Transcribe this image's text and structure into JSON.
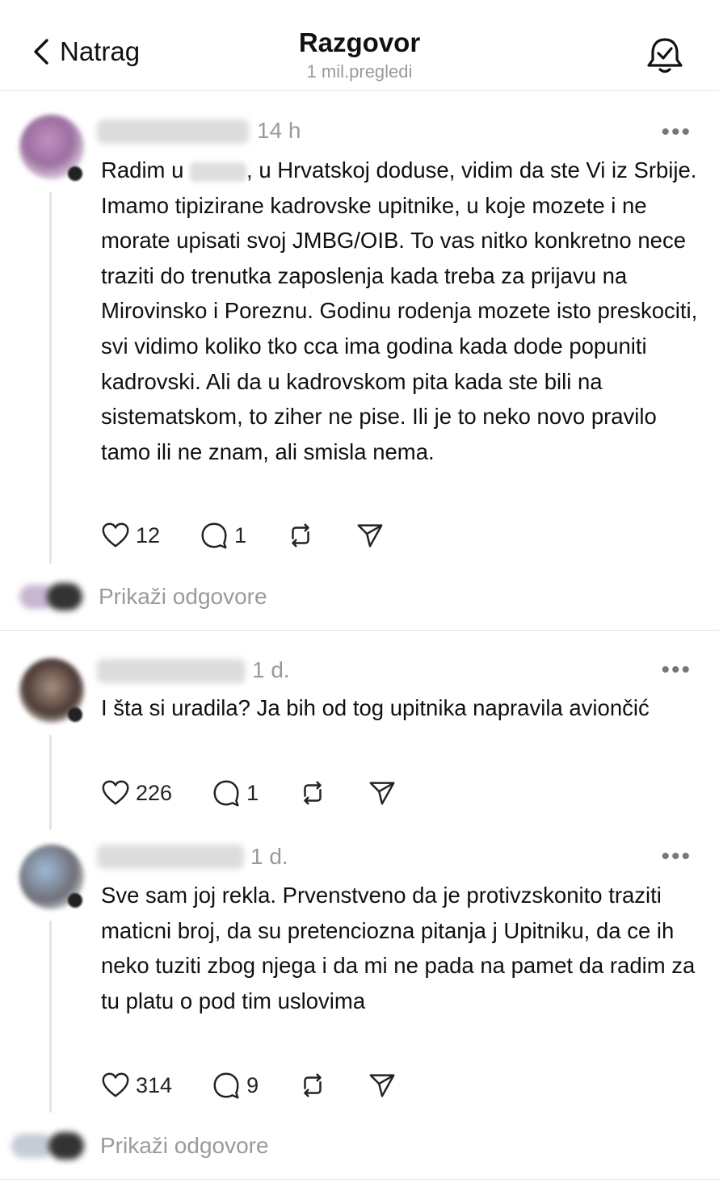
{
  "header": {
    "back_label": "Natrag",
    "title": "Razgovor",
    "subtitle": "1 mil.pregledi"
  },
  "posts": [
    {
      "time": "14 h",
      "more": "•••",
      "text_before": "Radim u",
      "text_after": ", u Hrvatskoj doduse, vidim da ste Vi iz Srbije. Imamo tipizirane kadrovske upitnike, u koje mozete i ne morate upisati svoj JMBG/OIB. To vas nitko konkretno nece traziti do trenutka zaposlenja kada treba za prijavu na Mirovinsko i Poreznu. Godinu rodenja mozete isto preskociti, svi vidimo koliko tko cca ima godina kada dode popuniti kadrovski. Ali da u kadrovskom pita kada ste bili na sistematskom, to ziher ne pise. Ili je to neko novo pravilo tamo ili ne znam, ali smisla nema.",
      "likes": "12",
      "comments": "1",
      "show_replies": "Prikaži odgovore"
    },
    {
      "time": "1 d.",
      "more": "•••",
      "text": "I šta si uradila? Ja bih od tog upitnika napravila aviončić",
      "likes": "226",
      "comments": "1"
    },
    {
      "time": "1 d.",
      "more": "•••",
      "text": "Sve sam joj rekla. Prvenstveno da je protivzskonito traziti maticni broj, da su pretenciozna pitanja j Upitniku, da ce ih neko tuziti zbog njega i da mi ne pada na pamet da radim za tu platu o pod tim uslovima",
      "likes": "314",
      "comments": "9",
      "show_replies": "Prikaži odgovore"
    }
  ],
  "icons": {
    "back": "chevron-left-icon",
    "bell": "bell-check-icon",
    "like": "heart-icon",
    "comment": "comment-icon",
    "repost": "repost-icon",
    "share": "share-icon"
  }
}
